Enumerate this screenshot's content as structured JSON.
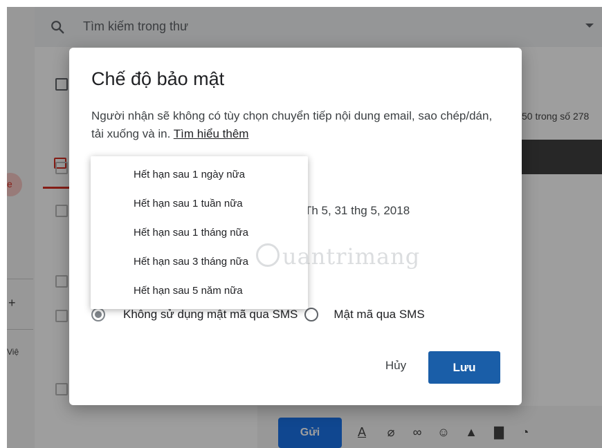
{
  "search": {
    "placeholder": "Tìm kiếm trong thư"
  },
  "mail_list": {
    "page_count": "50 trong số 278"
  },
  "left_nav": {
    "vie_label": "Việ"
  },
  "compose": {
    "send_label": "Gửi"
  },
  "dialog": {
    "title": "Chế độ bảo mật",
    "description": "Người nhận sẽ không có tùy chọn chuyển tiếp nội dung email, sao chép/dán, tải xuống và in.",
    "learn_more": "Tìm hiểu thêm",
    "expiration_date": "Th 5, 31 thg 5, 2018",
    "sms_options": [
      {
        "label": "Không sử dụng mật mã qua SMS",
        "selected": true
      },
      {
        "label": "Mật mã qua SMS",
        "selected": false
      }
    ],
    "cancel_label": "Hủy",
    "save_label": "Lưu"
  },
  "expiration_menu": {
    "items": [
      "Hết hạn sau 1 ngày nữa",
      "Hết hạn sau 1 tuần nữa",
      "Hết hạn sau 1 tháng nữa",
      "Hết hạn sau 3 tháng nữa",
      "Hết hạn sau 5 năm nữa"
    ]
  },
  "watermark": {
    "text": "uantrimang"
  },
  "colors": {
    "primary": "#1a5ea8",
    "send": "#1a73e8",
    "inbox_red": "#d93025"
  }
}
